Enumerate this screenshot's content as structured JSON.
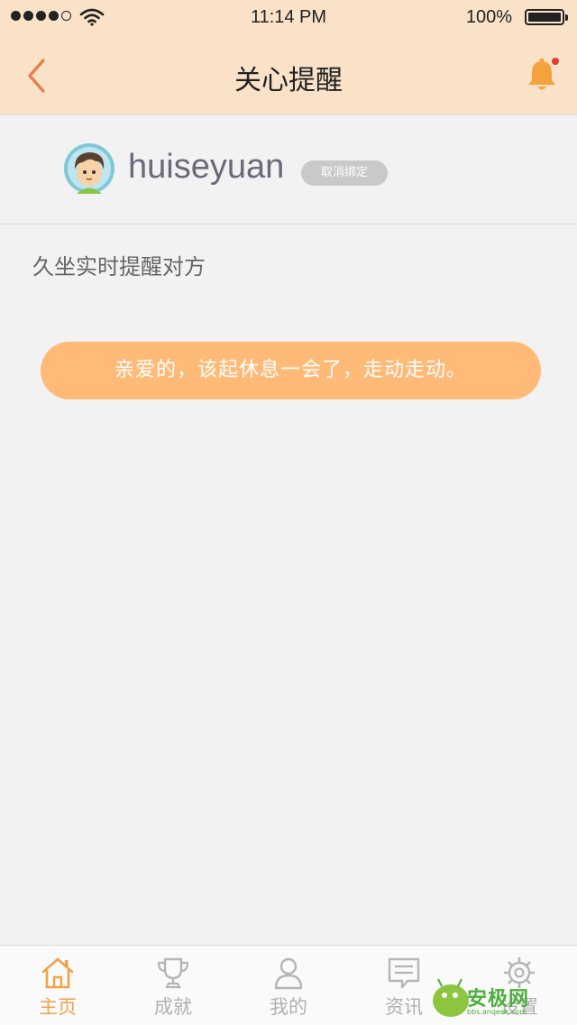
{
  "status_bar": {
    "time": "11:14 PM",
    "battery": "100%"
  },
  "header": {
    "title": "关心提醒"
  },
  "user": {
    "name": "huiseyuan",
    "unbind_label": "取消绑定"
  },
  "reminder": {
    "section_label": "久坐实时提醒对方",
    "message": "亲爱的，该起休息一会了，走动走动。"
  },
  "tabs": [
    {
      "label": "主页",
      "icon": "home-icon",
      "active": true
    },
    {
      "label": "成就",
      "icon": "trophy-icon",
      "active": false
    },
    {
      "label": "我的",
      "icon": "person-icon",
      "active": false
    },
    {
      "label": "资讯",
      "icon": "news-icon",
      "active": false
    },
    {
      "label": "设置",
      "icon": "gear-icon",
      "active": false
    }
  ],
  "watermark": {
    "text": "安极网",
    "sub": "bbs.anqeek.com"
  },
  "colors": {
    "header_bg": "#f9e2c8",
    "accent": "#f0a24a",
    "bubble": "#ffba78",
    "notification_dot": "#e53935"
  }
}
